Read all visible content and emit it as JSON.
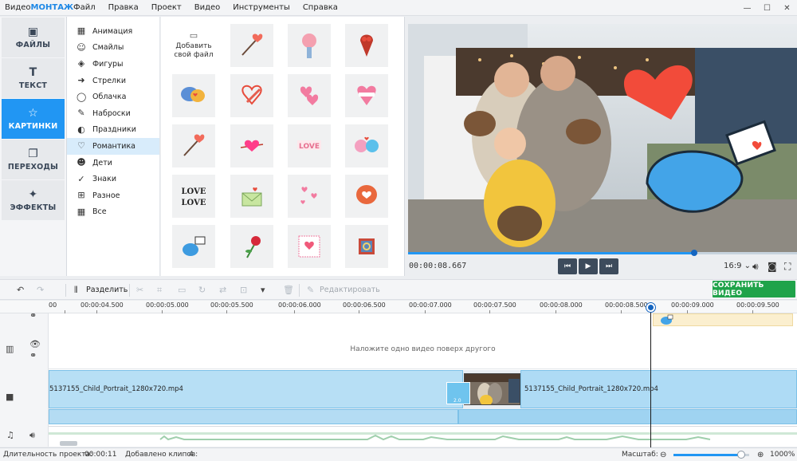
{
  "app": {
    "logo_prefix": "Видео",
    "logo_brand": "МОНТАЖ"
  },
  "menu": [
    "Файл",
    "Правка",
    "Проект",
    "Видео",
    "Инструменты",
    "Справка"
  ],
  "window_controls": {
    "minimize": "—",
    "maximize": "☐",
    "close": "✕"
  },
  "nav": [
    {
      "label": "ФАЙЛЫ",
      "icon": "image-icon",
      "glyph": "▣",
      "active": false
    },
    {
      "label": "ТЕКСТ",
      "icon": "text-icon",
      "glyph": "T",
      "active": false
    },
    {
      "label": "КАРТИНКИ",
      "icon": "star-icon",
      "glyph": "☆",
      "active": true
    },
    {
      "label": "ПЕРЕХОДЫ",
      "icon": "transitions-icon",
      "glyph": "❐",
      "active": false
    },
    {
      "label": "ЭФФЕКТЫ",
      "icon": "magic-wand-icon",
      "glyph": "✦",
      "active": false
    }
  ],
  "categories": [
    {
      "label": "Анимация",
      "icon": "film-icon",
      "glyph": "▦",
      "active": false
    },
    {
      "label": "Смайлы",
      "icon": "smile-icon",
      "glyph": "☺",
      "active": false
    },
    {
      "label": "Фигуры",
      "icon": "shapes-icon",
      "glyph": "◈",
      "active": false
    },
    {
      "label": "Стрелки",
      "icon": "arrow-icon",
      "glyph": "➜",
      "active": false
    },
    {
      "label": "Облачка",
      "icon": "speech-bubble-icon",
      "glyph": "◯",
      "active": false
    },
    {
      "label": "Наброски",
      "icon": "sketch-icon",
      "glyph": "✎",
      "active": false
    },
    {
      "label": "Праздники",
      "icon": "balloon-icon",
      "glyph": "◐",
      "active": false
    },
    {
      "label": "Романтика",
      "icon": "heart-icon",
      "glyph": "♡",
      "active": true
    },
    {
      "label": "Дети",
      "icon": "child-icon",
      "glyph": "☻",
      "active": false
    },
    {
      "label": "Знаки",
      "icon": "sign-icon",
      "glyph": "✓",
      "active": false
    },
    {
      "label": "Разное",
      "icon": "misc-icon",
      "glyph": "⊞",
      "active": false
    },
    {
      "label": "Все",
      "icon": "grid-icon",
      "glyph": "▦",
      "active": false
    }
  ],
  "stickers": {
    "add_label_line1": "Добавить",
    "add_label_line2": "свой файл",
    "items": [
      "heart-arrow-sticker",
      "heart-lock-sticker",
      "heart-bouquet-sticker",
      "love-bubbles-sticker",
      "heart-pencil-sticker",
      "pink-hearts-sticker",
      "i-love-you-heart-sticker",
      "heart-arrow-sticker",
      "heart-arrow-pink-sticker",
      "love-text-sticker",
      "birds-in-love-sticker",
      "love-love-text-sticker",
      "love-letter-sticker",
      "floating-hearts-sticker",
      "heart-speech-bubble-sticker",
      "bird-with-letter-sticker",
      "rose-sticker",
      "heart-stamp-sticker",
      "ring-box-sticker"
    ]
  },
  "preview": {
    "timecode": "00:00:08.667",
    "ratio": "16:9 ⌄",
    "progress": 0.73
  },
  "toolbar": {
    "split": "Разделить",
    "edit": "Редактировать",
    "save": "СОХРАНИТЬ ВИДЕО"
  },
  "ruler": [
    "00",
    "00:00:04.500",
    "00:00:05.000",
    "00:00:05.500",
    "00:00:06.000",
    "00:00:06.500",
    "00:00:07.000",
    "00:00:07.500",
    "00:00:08.000",
    "00:00:08.500",
    "00:00:09.000",
    "00:00:09.500"
  ],
  "timeline": {
    "overlay_hint": "Наложите одно видео поверх другого",
    "clip1": "5137155_Child_Portrait_1280x720.mp4",
    "clip2": "5137155_Child_Portrait_1280x720.mp4",
    "transition_duration": "2.0"
  },
  "status": {
    "duration_label": "Длительность проекта:",
    "duration_value": "00:00:11",
    "clips_label": "Добавлено клипов:",
    "clips_value": "4",
    "zoom_label": "Масштаб:",
    "zoom_value": "1000%",
    "zoom_level": 0.86
  }
}
